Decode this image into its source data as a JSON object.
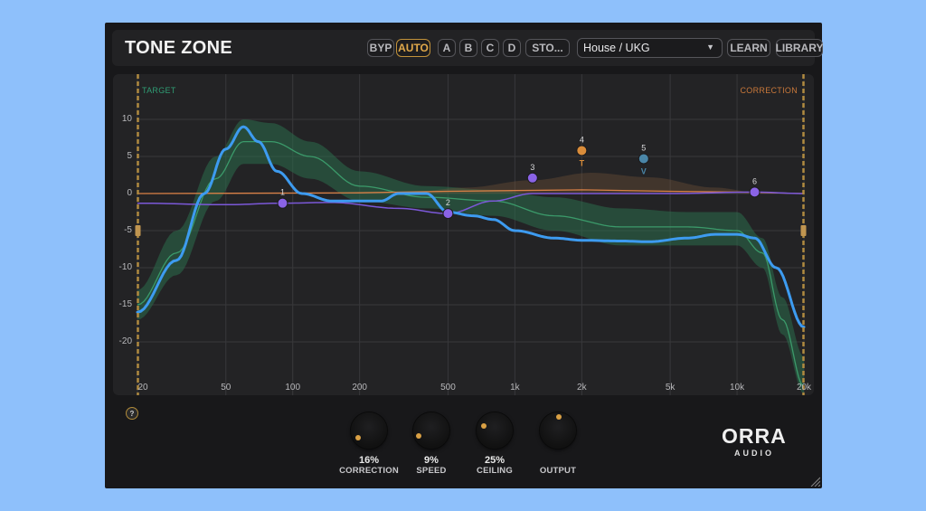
{
  "app": {
    "title": "TONE ZONE"
  },
  "toolbar": {
    "bypass": "BYP",
    "auto": "AUTO",
    "slot_a": "A",
    "slot_b": "B",
    "slot_c": "C",
    "slot_d": "D",
    "store": "STO...",
    "preset": "House / UKG",
    "learn": "LEARN",
    "library": "LIBRARY"
  },
  "graph": {
    "target_label": "TARGET",
    "correction_label": "CORRECTION",
    "y_ticks": [
      "10",
      "5",
      "0",
      "-5",
      "-10",
      "-15",
      "-20"
    ],
    "x_ticks": [
      "20",
      "50",
      "100",
      "200",
      "500",
      "1k",
      "2k",
      "5k",
      "10k",
      "20k"
    ],
    "nodes": [
      {
        "label": "1",
        "freq": 90,
        "gain": -1.3,
        "color": "#8a63e6"
      },
      {
        "label": "2",
        "freq": 500,
        "gain": -2.7,
        "color": "#8a63e6"
      },
      {
        "label": "3",
        "freq": 1200,
        "gain": 2.1,
        "color": "#8a63e6"
      },
      {
        "label": "4",
        "freq": 2000,
        "gain": 5.8,
        "color": "#d98c3a",
        "sub": "T"
      },
      {
        "label": "5",
        "freq": 3800,
        "gain": 4.7,
        "color": "#4a86a8",
        "sub": "V"
      },
      {
        "label": "6",
        "freq": 12000,
        "gain": 0.2,
        "color": "#8a63e6"
      }
    ],
    "colors": {
      "analysis_curve": "#3d9bf0",
      "target_band": "#2c6e4c",
      "target_line": "#3b9a6a",
      "correction_line": "#d98046",
      "eq_line": "#7b58d8",
      "boundary": "#b08a40"
    }
  },
  "controls": {
    "knobs": [
      {
        "value": "16%",
        "label": "CORRECTION"
      },
      {
        "value": "9%",
        "label": "SPEED"
      },
      {
        "value": "25%",
        "label": "CEILING"
      },
      {
        "value": "",
        "label": "OUTPUT"
      }
    ],
    "help": "?"
  },
  "brand": {
    "name": "ORRA",
    "sub": "AUDIO"
  }
}
